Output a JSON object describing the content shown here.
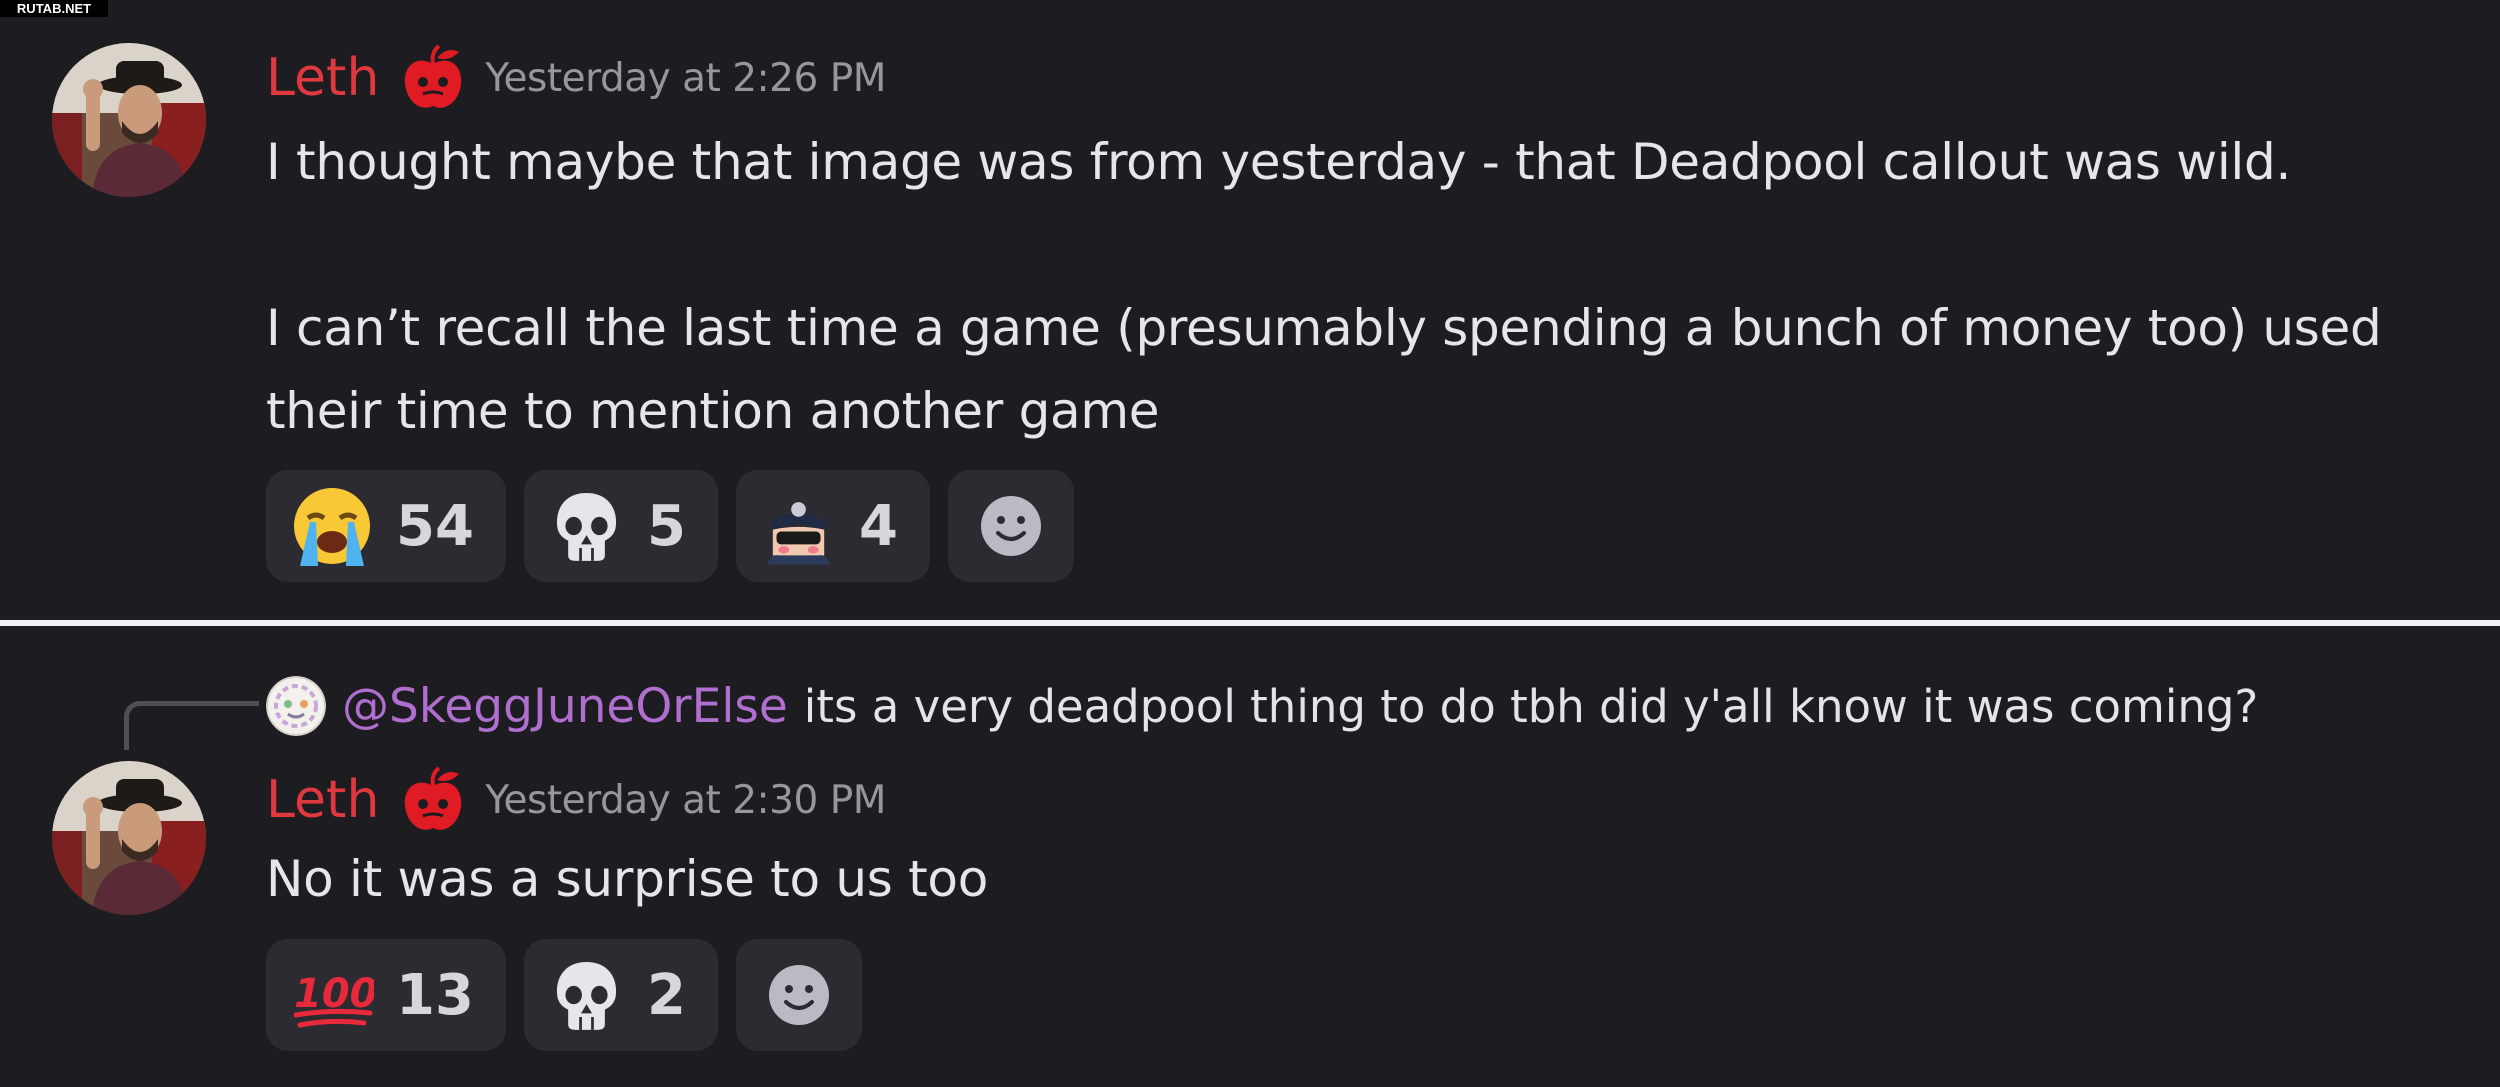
{
  "watermark": "RUTAB.NET",
  "messages": [
    {
      "author": "Leth",
      "timestamp": "Yesterday at 2:26 PM",
      "lines": [
        "I thought maybe that image was from yesterday - that Deadpool callout was wild.",
        "",
        "I can’t recall the last time a game (presumably spending a bunch of money too) used",
        "their time to mention another game"
      ],
      "reactions": [
        {
          "emoji": "loudly-crying-face-icon",
          "count": "54"
        },
        {
          "emoji": "skull-icon",
          "count": "5"
        },
        {
          "emoji": "cop-cat-emote-icon",
          "count": "4"
        }
      ]
    },
    {
      "reply": {
        "mention": "@SkeggJuneOrElse",
        "text": "its a very deadpool thing to do tbh did y'all know it was coming?"
      },
      "author": "Leth",
      "timestamp": "Yesterday at 2:30 PM",
      "lines": [
        "No it was a surprise to us too"
      ],
      "reactions": [
        {
          "emoji": "hundred-points-icon",
          "count": "13"
        },
        {
          "emoji": "skull-icon",
          "count": "2"
        }
      ]
    }
  ],
  "colors": {
    "background": "#1c1c21",
    "username": "#e0383f",
    "mention": "#b06fcf",
    "reaction_bg": "#2b2b31",
    "timestamp": "#96979e"
  }
}
